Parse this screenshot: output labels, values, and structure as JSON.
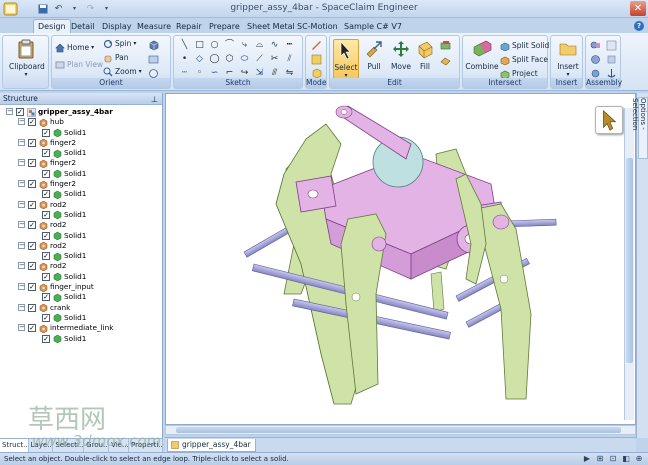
{
  "window": {
    "title": "gripper_assy_4bar - SpaceClaim Engineer"
  },
  "ribbon_tabs": [
    "Design",
    "Detail",
    "Display",
    "Measure",
    "Repair",
    "Prepare",
    "Sheet Metal",
    "SC-Motion",
    "Sample C# V7"
  ],
  "ribbon": {
    "clipboard": {
      "label": "Clipboard"
    },
    "orient": {
      "label": "Orient",
      "home": "Home",
      "plan_view": "Plan View",
      "spin": "Spin",
      "pan": "Pan",
      "zoom": "Zoom"
    },
    "sketch": {
      "label": "Sketch"
    },
    "mode": {
      "label": "Mode"
    },
    "edit": {
      "label": "Edit",
      "select": "Select",
      "pull": "Pull",
      "move": "Move",
      "fill": "Fill"
    },
    "intersect": {
      "label": "Intersect",
      "combine": "Combine",
      "split_solid": "Split Solid",
      "split_face": "Split Face",
      "project": "Project"
    },
    "insert": {
      "label": "Insert",
      "insert": "Insert"
    },
    "assembly": {
      "label": "Assembly"
    }
  },
  "structure_panel": {
    "title": "Structure",
    "tree": [
      {
        "label": "gripper_assy_4bar",
        "level": 0,
        "icon": "assembly-icon",
        "bold": true
      },
      {
        "label": "hub",
        "level": 1,
        "icon": "component-icon"
      },
      {
        "label": "Solid1",
        "level": 2,
        "icon": "solid-icon"
      },
      {
        "label": "finger2",
        "level": 1,
        "icon": "component-icon"
      },
      {
        "label": "Solid1",
        "level": 2,
        "icon": "solid-icon"
      },
      {
        "label": "finger2",
        "level": 1,
        "icon": "component-icon"
      },
      {
        "label": "Solid1",
        "level": 2,
        "icon": "solid-icon"
      },
      {
        "label": "finger2",
        "level": 1,
        "icon": "component-icon"
      },
      {
        "label": "Solid1",
        "level": 2,
        "icon": "solid-icon"
      },
      {
        "label": "rod2",
        "level": 1,
        "icon": "component-icon"
      },
      {
        "label": "Solid1",
        "level": 2,
        "icon": "solid-icon"
      },
      {
        "label": "rod2",
        "level": 1,
        "icon": "component-icon"
      },
      {
        "label": "Solid1",
        "level": 2,
        "icon": "solid-icon"
      },
      {
        "label": "rod2",
        "level": 1,
        "icon": "component-icon"
      },
      {
        "label": "Solid1",
        "level": 2,
        "icon": "solid-icon"
      },
      {
        "label": "rod2",
        "level": 1,
        "icon": "component-icon"
      },
      {
        "label": "Solid1",
        "level": 2,
        "icon": "solid-icon"
      },
      {
        "label": "finger_input",
        "level": 1,
        "icon": "component-icon"
      },
      {
        "label": "Solid1",
        "level": 2,
        "icon": "solid-icon"
      },
      {
        "label": "crank",
        "level": 1,
        "icon": "component-icon"
      },
      {
        "label": "Solid1",
        "level": 2,
        "icon": "solid-icon"
      },
      {
        "label": "intermediate_link",
        "level": 1,
        "icon": "component-icon"
      },
      {
        "label": "Solid1",
        "level": 2,
        "icon": "solid-icon"
      }
    ]
  },
  "panel_tabs": [
    "Struct...",
    "Laye...",
    "Selecti...",
    "Grou...",
    "Vie...",
    "Properti..."
  ],
  "document_tab": "gripper_assy_4bar",
  "options_panel": {
    "label": "Options - Selection"
  },
  "status": {
    "text": "Select an object. Double-click to select an edge loop. Triple-click to select a solid."
  },
  "watermark": {
    "brand": "草西网",
    "url": "www.3dmox.com"
  },
  "colors": {
    "finger": "#cfe2a8",
    "hub": "#e3b3e6",
    "rod": "#a9a9d8",
    "disc": "#bfe0e0",
    "ribbon_bg": "#dce8f7",
    "accent": "#f7c85c"
  }
}
